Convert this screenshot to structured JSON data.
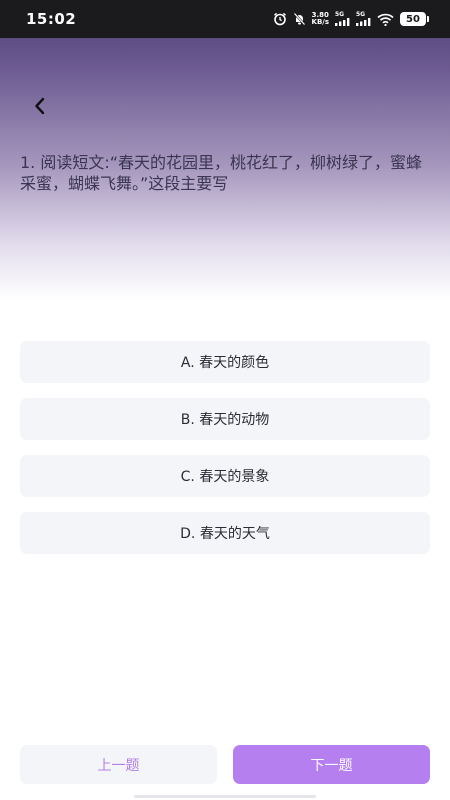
{
  "status_bar": {
    "time": "15:02",
    "net_speed_value": "3.80",
    "net_speed_unit": "KB/s",
    "signal1_label": "5G",
    "signal2_label": "5G",
    "battery": "50",
    "icons": [
      "alarm-icon",
      "mute-icon",
      "signal-icon",
      "signal-icon",
      "wifi-icon",
      "battery-icon"
    ]
  },
  "header": {
    "back_icon": "chevron-left-icon"
  },
  "question": {
    "text": "1. 阅读短文:“春天的花园里，桃花红了，柳树绿了，蜜蜂采蜜，蝴蝶飞舞。”这段主要写"
  },
  "options": [
    {
      "label": "A. 春天的颜色"
    },
    {
      "label": "B. 春天的动物"
    },
    {
      "label": "C. 春天的景象"
    },
    {
      "label": "D. 春天的天气"
    }
  ],
  "nav": {
    "prev_label": "上一题",
    "next_label": "下一题"
  },
  "colors": {
    "accent": "#b57ff0",
    "header_top": "#4e3f74",
    "option_bg": "#f4f5f8"
  }
}
